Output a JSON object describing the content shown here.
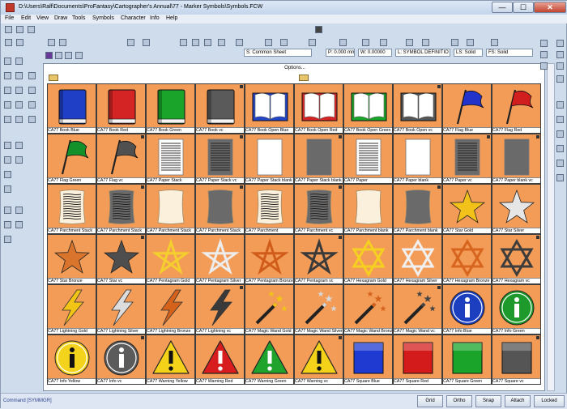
{
  "window": {
    "title": "D:\\Users\\Ralf\\Documents\\ProFantasy\\Cartographer's Annual\\77 - Marker Symbols\\Symbols.FCW",
    "min": "—",
    "max": "☐",
    "close": "✕"
  },
  "menu": [
    "File",
    "Edit",
    "View",
    "Draw",
    "Tools",
    "Symbols",
    "Character",
    "Info",
    "Help"
  ],
  "status_fields": {
    "sheet": "S: Common Sheet",
    "pen": "P: 0.000 mm",
    "width": "W: 0.00000",
    "layer": "L: SYMBOL DEFINITIO",
    "linestyle": "LS: Solid",
    "fillstyle": "FS: Solid"
  },
  "panel": {
    "options_label": "Options..."
  },
  "symbols": [
    {
      "label": "CA77 Book Blue",
      "kind": "book",
      "color": "#1f3fc7"
    },
    {
      "label": "CA77 Book Red",
      "kind": "book",
      "color": "#d42424"
    },
    {
      "label": "CA77 Book Green",
      "kind": "book",
      "color": "#1aa52a"
    },
    {
      "label": "CA77 Book vc",
      "kind": "book",
      "color": "#5a5a5a",
      "mark": true
    },
    {
      "label": "CA77 Book Open Blue",
      "kind": "openbook",
      "color": "#2444c8"
    },
    {
      "label": "CA77 Book Open Red",
      "kind": "openbook",
      "color": "#d42424"
    },
    {
      "label": "CA77 Book Open Green",
      "kind": "openbook",
      "color": "#1aa52a"
    },
    {
      "label": "CA77 Book Open vc",
      "kind": "openbook",
      "color": "#555555",
      "mark": true
    },
    {
      "label": "CA77 Flag Blue",
      "kind": "flag",
      "color": "#2233cc"
    },
    {
      "label": "CA77 Flag Red",
      "kind": "flag",
      "color": "#d11f1f"
    },
    {
      "label": "CA77 Flag Green",
      "kind": "flag",
      "color": "#12902a"
    },
    {
      "label": "CA77 Flag vc",
      "kind": "flag",
      "color": "#505050",
      "mark": true
    },
    {
      "label": "CA77 Paper Stack",
      "kind": "paperlines",
      "color": "#ffffff"
    },
    {
      "label": "CA77 Paper Stack vc",
      "kind": "paperlines",
      "color": "#6a6a6a",
      "mark": true
    },
    {
      "label": "CA77 Paper Stack blank",
      "kind": "paper",
      "color": "#ffffff"
    },
    {
      "label": "CA77 Paper Stack blank",
      "kind": "paper",
      "color": "#6a6a6a",
      "mark": true
    },
    {
      "label": "CA77 Paper",
      "kind": "paperlines",
      "color": "#ffffff"
    },
    {
      "label": "CA77 Paper blank",
      "kind": "paper",
      "color": "#ffffff"
    },
    {
      "label": "CA77 Paper vc",
      "kind": "paperlines",
      "color": "#6a6a6a",
      "mark": true
    },
    {
      "label": "CA77 Paper blank vc",
      "kind": "paper",
      "color": "#6a6a6a",
      "mark": true
    },
    {
      "label": "CA77 Parchment Stack",
      "kind": "parchlines",
      "color": "#fbf0dc"
    },
    {
      "label": "CA77 Parchment Stack",
      "kind": "parchlines",
      "color": "#6a6a6a",
      "mark": true
    },
    {
      "label": "CA77 Parchment Stack",
      "kind": "parch",
      "color": "#fbf0dc"
    },
    {
      "label": "CA77 Parchment Stack",
      "kind": "parch",
      "color": "#6a6a6a",
      "mark": true
    },
    {
      "label": "CA77 Parchment",
      "kind": "parchlines",
      "color": "#fbf0dc"
    },
    {
      "label": "CA77 Parchment vc",
      "kind": "parchlines",
      "color": "#6a6a6a",
      "mark": true
    },
    {
      "label": "CA77 Parchment blank",
      "kind": "parch",
      "color": "#fbf0dc"
    },
    {
      "label": "CA77 Parchment blank",
      "kind": "parch",
      "color": "#6a6a6a",
      "mark": true
    },
    {
      "label": "CA77 Star Gold",
      "kind": "star",
      "color": "#f2c21a"
    },
    {
      "label": "CA77 Star Silver",
      "kind": "star",
      "color": "#e6e6e6"
    },
    {
      "label": "CA77 Star Bronze",
      "kind": "star",
      "color": "#d9742c"
    },
    {
      "label": "CA77 Star vc",
      "kind": "star",
      "color": "#4e4e4e",
      "mark": true
    },
    {
      "label": "CA77 Pentagram Gold",
      "kind": "pentagram",
      "color": "#f4cf2e"
    },
    {
      "label": "CA77 Pentagram Silver",
      "kind": "pentagram",
      "color": "#ededed"
    },
    {
      "label": "CA77 Pentagram Bronze",
      "kind": "pentagram",
      "color": "#d15c1a"
    },
    {
      "label": "CA77 Pentagram vc",
      "kind": "pentagram",
      "color": "#3a3a3a",
      "mark": true
    },
    {
      "label": "CA77 Hexagram Gold",
      "kind": "hexagram",
      "color": "#f5d020"
    },
    {
      "label": "CA77 Hexagram Silver",
      "kind": "hexagram",
      "color": "#f0f0f0"
    },
    {
      "label": "CA77 Hexagram Bronze",
      "kind": "hexagram",
      "color": "#d8651e"
    },
    {
      "label": "CA77 Hexagram vc",
      "kind": "hexagram",
      "color": "#3d3d3d",
      "mark": true
    },
    {
      "label": "CA77 Lightning Gold",
      "kind": "bolt",
      "color": "#f2c416"
    },
    {
      "label": "CA77 Lightning Silver",
      "kind": "bolt",
      "color": "#dcdcdc"
    },
    {
      "label": "CA77 Lightning Bronze",
      "kind": "bolt",
      "color": "#d5621b"
    },
    {
      "label": "CA77 Lightning vc",
      "kind": "bolt",
      "color": "#3a3a3a",
      "mark": true
    },
    {
      "label": "CA77 Magic Wand Gold",
      "kind": "wand",
      "color": "#f2c416"
    },
    {
      "label": "CA77 Magic Wand Silver",
      "kind": "wand",
      "color": "#d8d8d8"
    },
    {
      "label": "CA77 Magic Wand Bronze",
      "kind": "wand",
      "color": "#d5621b"
    },
    {
      "label": "CA77 Magic Wand vc",
      "kind": "wand",
      "color": "#444444",
      "mark": true
    },
    {
      "label": "CA77 Info Blue",
      "kind": "info",
      "color": "#1c3fc0"
    },
    {
      "label": "CA77 Info Green",
      "kind": "info",
      "color": "#1d9a2b"
    },
    {
      "label": "CA77 Info Yellow",
      "kind": "info",
      "color": "#f3d31c"
    },
    {
      "label": "CA77 Info vc",
      "kind": "info",
      "color": "#5b5b5b",
      "mark": true
    },
    {
      "label": "CA77 Warning Yellow",
      "kind": "warn",
      "color": "#f4d21a"
    },
    {
      "label": "CA77 Warning Red",
      "kind": "warn",
      "color": "#d71d1d"
    },
    {
      "label": "CA77 Warning Green",
      "kind": "warn",
      "color": "#1fa32c"
    },
    {
      "label": "CA77 Warning vc",
      "kind": "warn",
      "color": "#f4d21a",
      "mark": true
    },
    {
      "label": "CA77 Square Blue",
      "kind": "square",
      "color": "#1f3ad0"
    },
    {
      "label": "CA77 Square Red",
      "kind": "square",
      "color": "#d41b1b"
    },
    {
      "label": "CA77 Square Green",
      "kind": "square",
      "color": "#1aa52a"
    },
    {
      "label": "CA77 Square vc",
      "kind": "square",
      "color": "#555555",
      "mark": true
    }
  ],
  "status": {
    "command": "Command [SYMMGR]",
    "buttons": [
      "Grid",
      "Ortho",
      "Snap",
      "Attach",
      "Locked"
    ]
  }
}
